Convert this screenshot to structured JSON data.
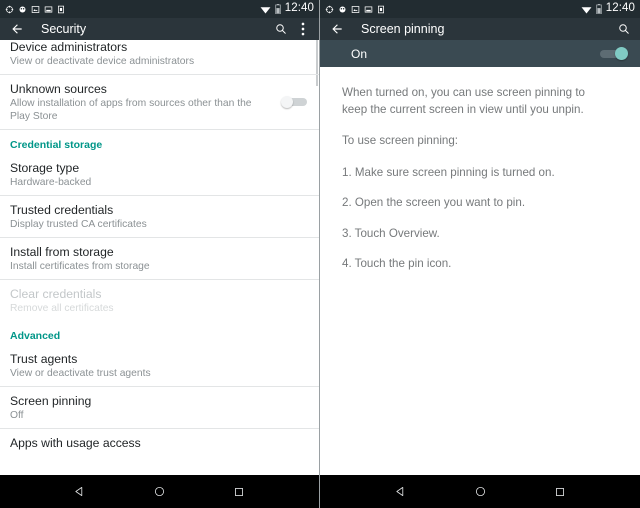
{
  "status_bar": {
    "icons": [
      "sync-icon",
      "sync-icon-2",
      "screenshot-icon",
      "screenshot-icon-2",
      "sim-icon"
    ],
    "wifi_icon": "wifi-icon",
    "battery_icon": "battery-icon",
    "time": "12:40"
  },
  "colors": {
    "action_bar": "#2b353b",
    "status_bar": "#222c31",
    "section_header": "#009688",
    "toggle_on_knob": "#80cbc4",
    "pin_row_bg": "#3a4a52",
    "nav_bar": "#000000"
  },
  "left_screen": {
    "title": "Security",
    "back_icon": "back-arrow-icon",
    "search_icon": "search-icon",
    "overflow_icon": "overflow-menu-icon",
    "rows": [
      {
        "name": "device-administrators",
        "title": "Device administrators",
        "subtitle": "View or deactivate device administrators",
        "disabled": false,
        "clipped": true
      },
      {
        "name": "unknown-sources",
        "title": "Unknown sources",
        "subtitle": "Allow installation of apps from sources other than the Play Store",
        "disabled": false,
        "toggle": "off"
      },
      {
        "name": "credential-storage-header",
        "type": "section",
        "title": "Credential storage"
      },
      {
        "name": "storage-type",
        "title": "Storage type",
        "subtitle": "Hardware-backed",
        "disabled": false
      },
      {
        "name": "trusted-credentials",
        "title": "Trusted credentials",
        "subtitle": "Display trusted CA certificates",
        "disabled": false
      },
      {
        "name": "install-from-storage",
        "title": "Install from storage",
        "subtitle": "Install certificates from storage",
        "disabled": false
      },
      {
        "name": "clear-credentials",
        "title": "Clear credentials",
        "subtitle": "Remove all certificates",
        "disabled": true
      },
      {
        "name": "advanced-header",
        "type": "section",
        "title": "Advanced"
      },
      {
        "name": "trust-agents",
        "title": "Trust agents",
        "subtitle": "View or deactivate trust agents",
        "disabled": false
      },
      {
        "name": "screen-pinning",
        "title": "Screen pinning",
        "subtitle": "Off",
        "disabled": false
      },
      {
        "name": "apps-with-usage-access",
        "title": "Apps with usage access",
        "subtitle": "",
        "disabled": false
      }
    ]
  },
  "right_screen": {
    "title": "Screen pinning",
    "back_icon": "back-arrow-icon",
    "search_icon": "search-icon",
    "toggle_label": "On",
    "toggle_state": "on",
    "paragraphs": [
      "When turned on, you can use screen pinning to keep the current screen in view until you unpin.",
      "To use screen pinning:",
      "1. Make sure screen pinning is turned on.",
      "2. Open the screen you want to pin.",
      "3. Touch Overview.",
      "4. Touch the pin icon."
    ]
  },
  "nav_bar": {
    "back": "back-triangle-icon",
    "home": "home-circle-icon",
    "recents": "recents-square-icon"
  }
}
